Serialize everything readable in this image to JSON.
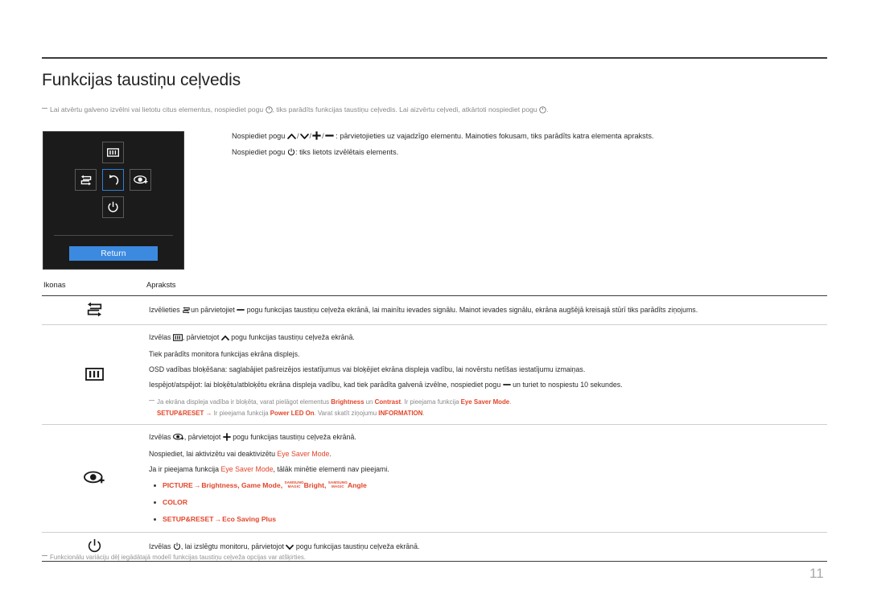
{
  "document": {
    "title": "Funkcijas taustiņu ceļvedis",
    "page_number": "11",
    "accent_color": "#e2452a",
    "intro_note_part1": "Lai atvērtu galveno izvēlni vai lietotu citus elementus, nospiediet pogu",
    "intro_note_part2": ", tiks parādīts funkcijas taustiņu ceļvedis. Lai aizvērtu ceļvedi, atkārtoti nospiediet pogu",
    "intro_note_part3": ".",
    "footer_note": "Funkcionālu variāciju dēļ iegādātajā modelī funkcijas taustiņu ceļveža opcijas var atšķirties."
  },
  "osd_panel": {
    "keys": {
      "up": "menu-icon",
      "left": "source-icon",
      "center": "return-icon",
      "right": "eye-saver-icon",
      "down": "power-icon"
    },
    "return_label": "Return"
  },
  "instructions": {
    "line1_prefix": "Nospiediet pogu",
    "line1_suffix": ": pārvietojieties uz vajadzīgo elementu. Mainoties fokusam, tiks parādīts katra elementa apraksts.",
    "line2_prefix": "Nospiediet pogu",
    "line2_suffix": ": tiks lietots izvēlētais elements."
  },
  "table": {
    "headers": {
      "icon": "Ikonas",
      "description": "Apraksts"
    },
    "rows": [
      {
        "icon": "source-icon",
        "lines": [
          {
            "before": "Izvēlieties",
            "inline_icon_1": "source-icon",
            "middle": "un pārvietojiet",
            "inline_icon_2": "minus-icon",
            "after": "pogu funkcijas taustiņu ceļveža ekrānā, lai mainītu ievades signālu. Mainot ievades signālu, ekrāna augšējā kreisajā stūrī tiks parādīts ziņojums."
          }
        ]
      },
      {
        "icon": "menu-icon",
        "lines": [
          {
            "before": "Izvēlas",
            "inline_icon_1": "menu-icon",
            "middle": ", pārvietojot",
            "inline_icon_2": "up-arrow-icon",
            "after": "pogu funkcijas taustiņu ceļveža ekrānā."
          },
          {
            "text": "Tiek parādīts monitora funkcijas ekrāna displejs."
          },
          {
            "text": "OSD vadības bloķēšana: saglabājiet pašreizējos iestatījumus vai bloķējiet ekrāna displeja vadību, lai novērstu netīšas iestatījumu izmaiņas."
          },
          {
            "before": "Iespējot/atspējot: lai bloķētu/atbloķētu ekrāna displeja vadību, kad tiek parādīta galvenā izvēlne, nospiediet pogu",
            "inline_icon_2": "minus-icon",
            "after": "un turiet to nospiestu 10 sekundes."
          }
        ],
        "subnotes": [
          {
            "segments": [
              {
                "text": "Ja ekrāna displeja vadība ir bloķēta, varat pielāgot elementus ",
                "style": "muted"
              },
              {
                "text": "Brightness",
                "style": "accent"
              },
              {
                "text": " un ",
                "style": "muted"
              },
              {
                "text": "Contrast",
                "style": "accent"
              },
              {
                "text": ". Ir pieejama funkcija ",
                "style": "muted"
              },
              {
                "text": "Eye Saver Mode",
                "style": "accent"
              },
              {
                "text": ".",
                "style": "muted"
              }
            ]
          },
          {
            "indent": true,
            "segments": [
              {
                "text": "SETUP&RESET",
                "style": "accent"
              },
              {
                "text": " → ",
                "style": "accent-plain"
              },
              {
                "text": "Ir pieejama funkcija ",
                "style": "muted"
              },
              {
                "text": "Power LED On",
                "style": "accent"
              },
              {
                "text": ". Varat skatīt ziņojumu ",
                "style": "muted"
              },
              {
                "text": "INFORMATION",
                "style": "accent"
              },
              {
                "text": ".",
                "style": "muted"
              }
            ]
          }
        ]
      },
      {
        "icon": "eye-saver-icon",
        "lines": [
          {
            "before": "Izvēlas",
            "inline_icon_1": "eye-saver-icon",
            "middle": ", pārvietojot",
            "inline_icon_2": "plus-icon",
            "after": "pogu funkcijas taustiņu ceļveža ekrānā."
          },
          {
            "before_plain": "Nospiediet, lai aktivizētu vai deaktivizētu ",
            "accent_text": "Eye Saver Mode",
            "after_plain": "."
          },
          {
            "before_plain": "Ja ir pieejama funkcija ",
            "accent_text": "Eye Saver Mode",
            "after_plain": ", tālāk minētie elementi nav pieejami."
          }
        ],
        "bullets": [
          {
            "parts": [
              {
                "text": "PICTURE",
                "type": "text"
              },
              {
                "text": "→",
                "type": "arrow"
              },
              {
                "text": "Brightness, Game Mode, ",
                "type": "text"
              },
              {
                "text": "SAMSUNG|MAGIC",
                "type": "magic"
              },
              {
                "text": "Bright, ",
                "type": "text"
              },
              {
                "text": "SAMSUNG|MAGIC",
                "type": "magic"
              },
              {
                "text": "Angle",
                "type": "text"
              }
            ]
          },
          {
            "parts": [
              {
                "text": "COLOR",
                "type": "text"
              }
            ]
          },
          {
            "parts": [
              {
                "text": "SETUP&RESET",
                "type": "text"
              },
              {
                "text": "→",
                "type": "arrow"
              },
              {
                "text": "Eco Saving Plus",
                "type": "text"
              }
            ]
          }
        ]
      },
      {
        "icon": "power-icon",
        "lines": [
          {
            "before": "Izvēlas",
            "inline_icon_1": "power-icon",
            "middle": ", lai izslēgtu monitoru, pārvietojot",
            "inline_icon_2": "down-arrow-icon",
            "after": "pogu funkcijas taustiņu ceļveža ekrānā."
          }
        ]
      }
    ]
  }
}
